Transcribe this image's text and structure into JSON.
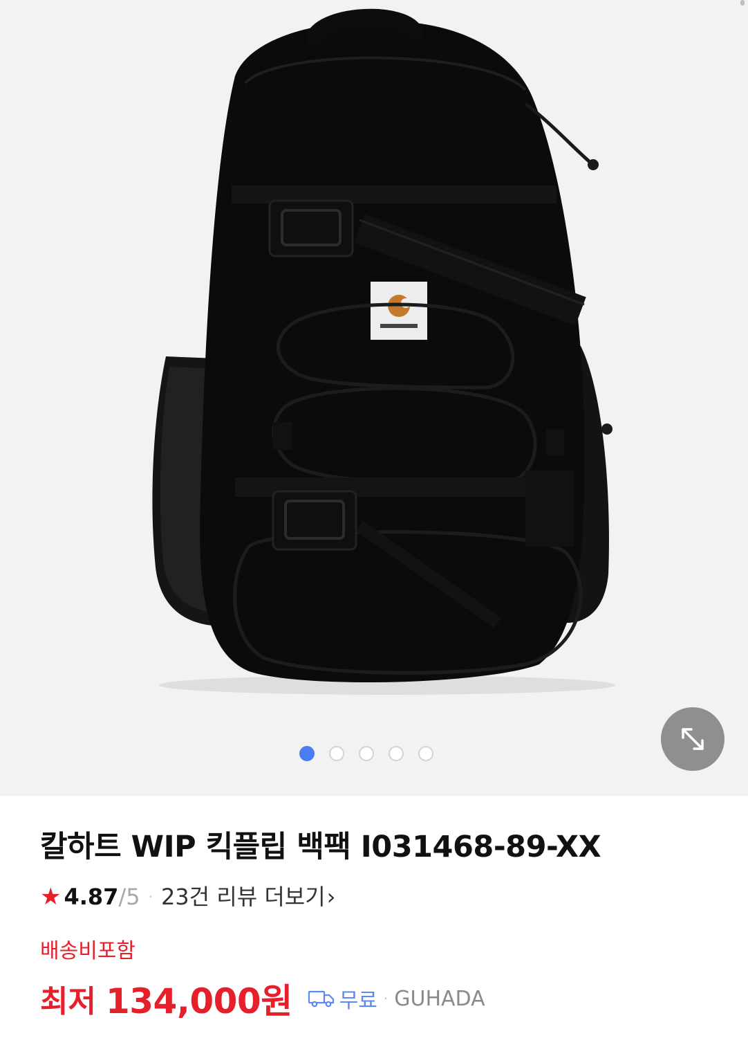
{
  "product": {
    "title": "칼하트 WIP 킥플립 백팩 I031468-89-XX",
    "image_alt": "Carhartt WIP Kickflip backpack black",
    "patch_text": "carhartt"
  },
  "gallery": {
    "image_count": 5,
    "active_index": 0
  },
  "rating": {
    "star": "★",
    "value": "4.87",
    "max": "/5",
    "separator": "·",
    "reviews_label": "23건 리뷰 더보기",
    "chevron": "›"
  },
  "shipping": {
    "included_label": "배송비포함",
    "free_label": "무료",
    "separator": "·"
  },
  "price": {
    "lowest_label": "최저",
    "amount": "134,000원"
  },
  "seller": {
    "name": "GUHADA"
  },
  "colors": {
    "accent_red": "#e5202b",
    "link_blue": "#5b88f5",
    "dot_active": "#4a7cf2"
  }
}
